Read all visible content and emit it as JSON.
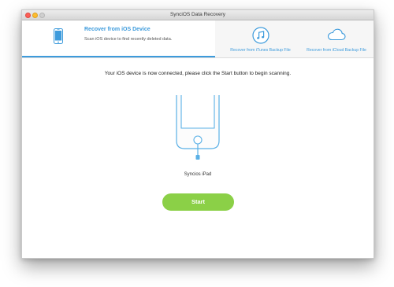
{
  "window": {
    "title": "SynciOS Data Recovery"
  },
  "tabs": {
    "ios_device": {
      "title": "Recover from iOS Device",
      "description": "Scan iOS device to find recently deleted data.",
      "icon": "phone-icon"
    },
    "itunes": {
      "label": "Recover from iTunes Backup File",
      "icon": "music-note-icon"
    },
    "icloud": {
      "label": "Recover from iCloud Backup File",
      "icon": "cloud-icon"
    }
  },
  "main": {
    "instruction": "Your iOS device is now connected, please click the Start button to begin scanning.",
    "device_name": "Syncios iPad",
    "device_icon": "iphone-usb-icon",
    "start_label": "Start"
  },
  "colors": {
    "accent": "#3d9bdc",
    "start_button": "#8bd047",
    "close": "#fc5f57",
    "minimize": "#fdbc2e",
    "maximize": "#cfcfcf"
  }
}
